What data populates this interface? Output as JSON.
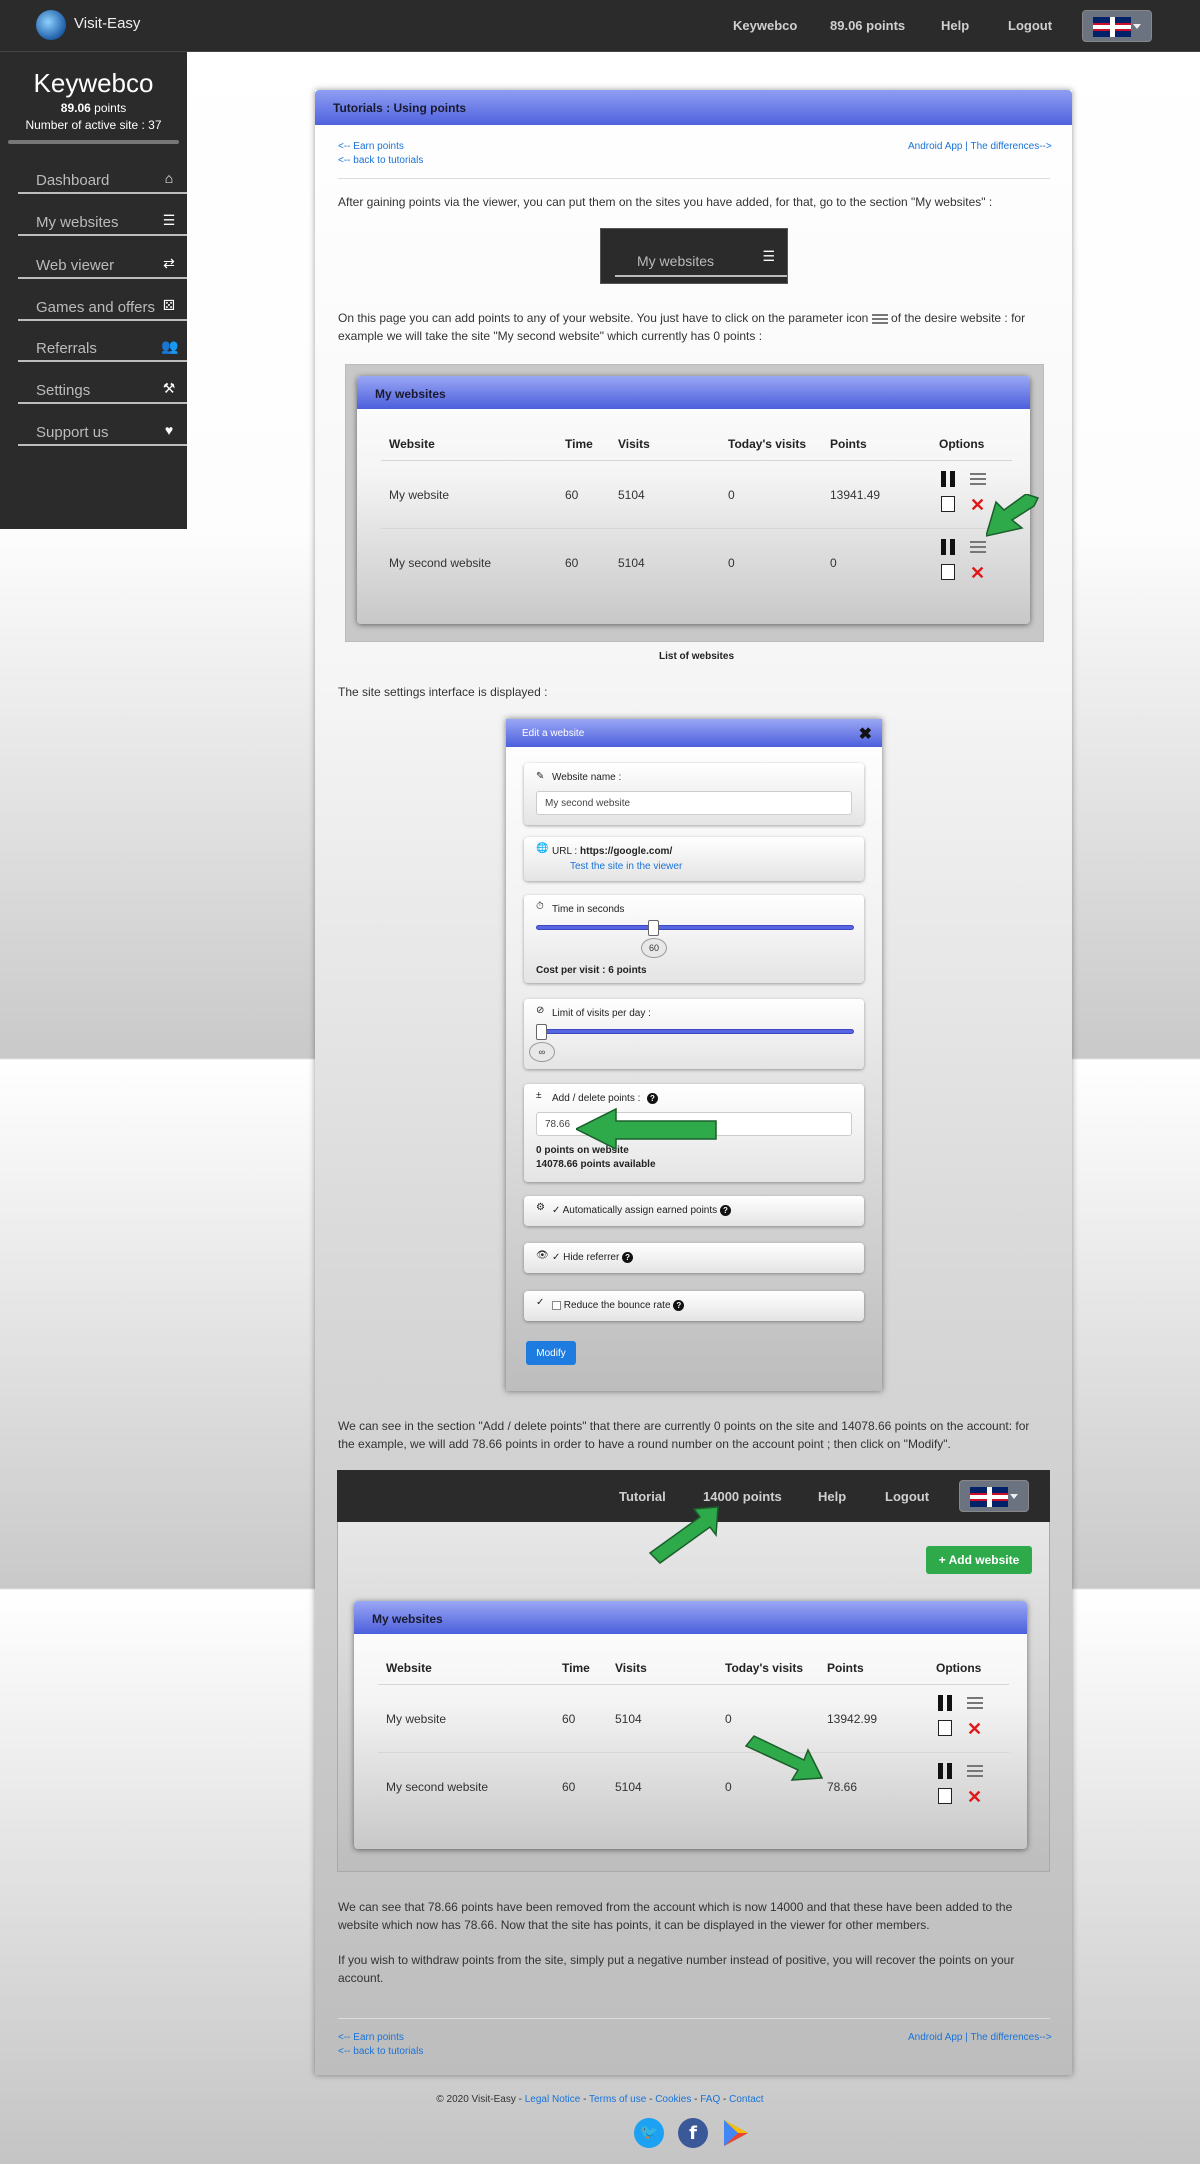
{
  "header": {
    "brand": "Visit-Easy",
    "nav": [
      "Keywebco",
      "89.06 points",
      "Help",
      "Logout"
    ]
  },
  "sidebar": {
    "username": "Keywebco",
    "points_value": "89.06",
    "points_unit": "points",
    "active_sites": "Number of active site : 37",
    "items": [
      {
        "label": "Dashboard",
        "icon": "home-icon"
      },
      {
        "label": "My websites",
        "icon": "list-icon"
      },
      {
        "label": "Web viewer",
        "icon": "exchange-icon"
      },
      {
        "label": "Games and offers",
        "icon": "dice-icon"
      },
      {
        "label": "Referrals",
        "icon": "users-icon"
      },
      {
        "label": "Settings",
        "icon": "tools-icon"
      },
      {
        "label": "Support us",
        "icon": "heart-icon"
      }
    ]
  },
  "tutorial": {
    "title": "Tutorials : Using points",
    "link_earn": "<-- Earn points",
    "link_back": "<-- back to tutorials",
    "link_next": "Android App | The differences-->",
    "p1": "After gaining points via the viewer, you can put them on the sites you have added, for that, go to the section \"My websites\" :",
    "widget_label": "My websites",
    "p2a": "On this page you can add points to any of your website. You just have to click on the parameter icon",
    "p2b": "of the desire website : for example we will take the site \"My second website\" which currently has 0 points :",
    "caption": "List of websites",
    "p3": "The site settings interface is displayed :",
    "p4": "We can see in the section \"Add / delete points\" that there are currently 0 points on the site and 14078.66 points on the account: for the example, we will add 78.66 points in order to have a round number on the account point ; then click on \"Modify\".",
    "p5": "We can see that 78.66 points have been removed from the account which is now 14000 and that these have been added to the website which now has 78.66. Now that the site has points, it can be displayed in the viewer for other members.",
    "p6": "If you wish to withdraw points from the site, simply put a negative number instead of positive, you will recover the points on your account."
  },
  "table1": {
    "title": "My websites",
    "columns": [
      "Website",
      "Time",
      "Visits",
      "Today's visits",
      "Points",
      "Options"
    ],
    "rows": [
      [
        "My website",
        "60",
        "5104",
        "0",
        "13941.49"
      ],
      [
        "My second website",
        "60",
        "5104",
        "0",
        "0"
      ]
    ]
  },
  "modal": {
    "title": "Edit a website",
    "name_label": "Website name :",
    "name_value": "My second website",
    "url_label": "URL :",
    "url_value": "https://google.com/",
    "test_link": "Test the site in the viewer",
    "time_label": "Time in seconds",
    "time_value": "60",
    "cost": "Cost per visit : 6 points",
    "limit_label": "Limit of visits per day :",
    "limit_value": "∞",
    "points_label": "Add / delete points :",
    "points_value": "78.66",
    "points_on_site": "0 points on website",
    "points_available": "14078.66 points available",
    "auto_label": "Automatically assign earned points",
    "hide_label": "Hide referrer",
    "bounce_label": "Reduce the bounce rate",
    "button": "Modify"
  },
  "header2": {
    "nav": [
      "Tutorial",
      "14000 points",
      "Help",
      "Logout"
    ],
    "add_button": "+ Add website"
  },
  "table2": {
    "title": "My websites",
    "columns": [
      "Website",
      "Time",
      "Visits",
      "Today's visits",
      "Points",
      "Options"
    ],
    "rows": [
      [
        "My website",
        "60",
        "5104",
        "0",
        "13942.99"
      ],
      [
        "My second website",
        "60",
        "5104",
        "0",
        "78.66"
      ]
    ]
  },
  "footer": {
    "copyright": "© 2020 Visit-Easy -",
    "links": [
      "Legal Notice",
      "Terms of use",
      "Cookies",
      "FAQ",
      "Contact"
    ]
  },
  "colors": {
    "accent": "#4f62dd",
    "arrow": "#2eaa4a",
    "danger": "#e01818",
    "link": "#1a73d9"
  }
}
